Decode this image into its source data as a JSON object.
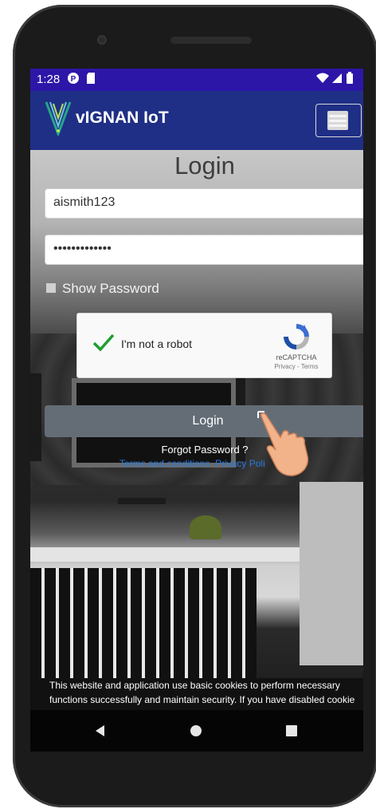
{
  "status_bar": {
    "time": "1:28"
  },
  "app_bar": {
    "brand": "vIGNAN IoT"
  },
  "login": {
    "title": "Login",
    "username_value": "aismith123",
    "password_value": "•••••••••••••",
    "show_password_label": "Show Password",
    "button_label": "Login",
    "forgot_password": "Forgot Password ?",
    "terms_link": "Terms and conditions",
    "privacy_link": "Privacy Poli"
  },
  "recaptcha": {
    "label": "I'm not a robot",
    "brand": "reCAPTCHA",
    "links": "Privacy - Terms"
  },
  "cookie_banner": {
    "line1": "This website and application use basic cookies to perform necessary",
    "line2": "functions successfully and maintain security. If you have disabled cookie"
  },
  "icons": {
    "status": [
      "notification-icon",
      "sd-card-icon",
      "wifi-icon",
      "signal-icon",
      "battery-icon"
    ],
    "nav": [
      "back-icon",
      "home-icon",
      "recents-icon"
    ]
  },
  "colors": {
    "status_bar": "#2c16a8",
    "app_bar": "#1f2f86",
    "login_button": "#646d76",
    "link": "#2a7be0",
    "check": "#1e9e2e"
  }
}
